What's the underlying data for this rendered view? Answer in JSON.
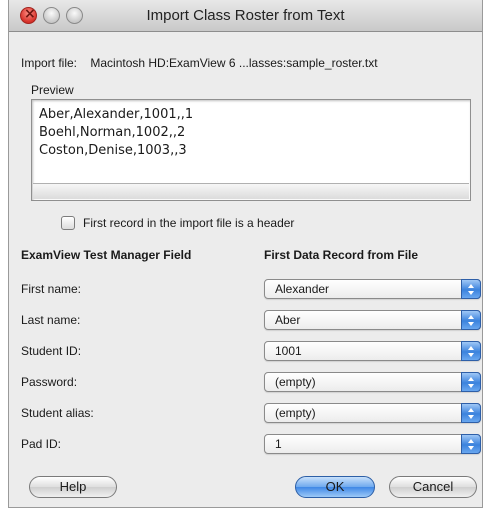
{
  "window": {
    "title": "Import Class Roster from Text"
  },
  "import_file": {
    "label": "Import file:",
    "value": "Macintosh HD:ExamView 6 ...lasses:sample_roster.txt"
  },
  "preview": {
    "label": "Preview",
    "lines": [
      "Aber,Alexander,1001,,1",
      "Boehl,Norman,1002,,2",
      "Coston,Denise,1003,,3"
    ]
  },
  "header_checkbox": {
    "label": "First record in the import file is a header",
    "checked": false
  },
  "columns": {
    "left": "ExamView Test Manager Field",
    "right": "First Data Record from File"
  },
  "fields": [
    {
      "label": "First name:",
      "value": "Alexander"
    },
    {
      "label": "Last name:",
      "value": "Aber"
    },
    {
      "label": "Student ID:",
      "value": "1001"
    },
    {
      "label": "Password:",
      "value": "(empty)"
    },
    {
      "label": "Student alias:",
      "value": "(empty)"
    },
    {
      "label": "Pad ID:",
      "value": "1"
    }
  ],
  "buttons": {
    "help": "Help",
    "ok": "OK",
    "cancel": "Cancel"
  }
}
